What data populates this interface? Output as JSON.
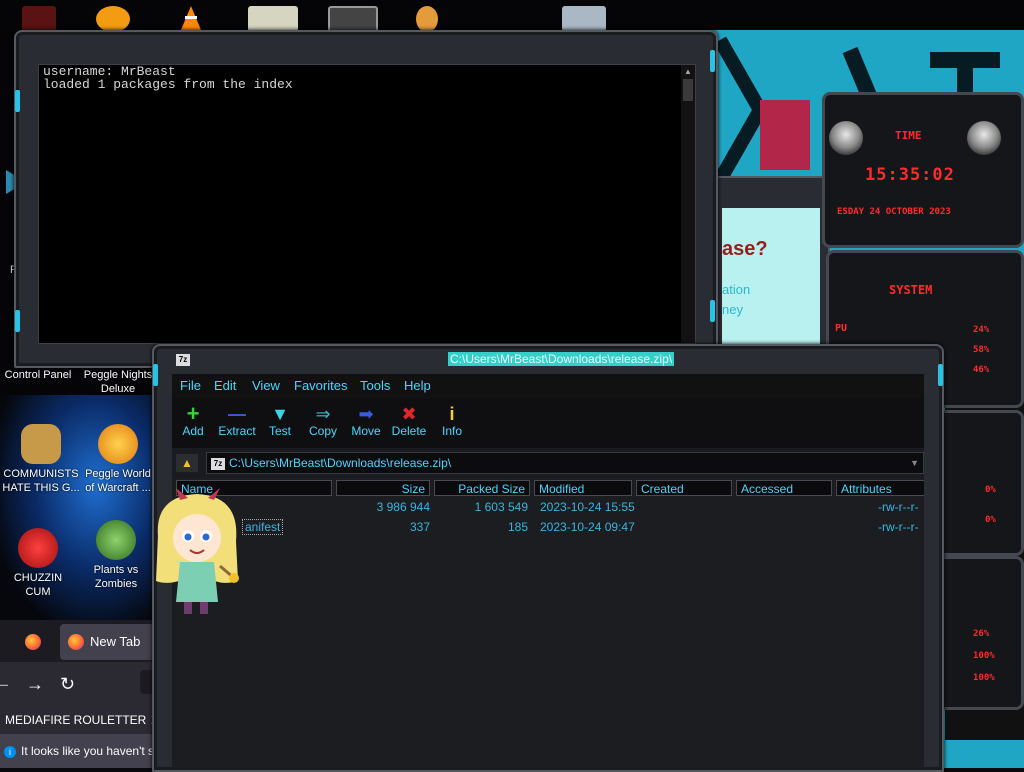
{
  "desktop": {
    "top_icons": [
      {
        "name": "app-icon-1",
        "color": "#c0392b"
      },
      {
        "name": "app-icon-2",
        "color": "#f39c12"
      },
      {
        "name": "vlc-icon",
        "color": "#ff8800"
      },
      {
        "name": "app-icon-4",
        "color": "#d5d5c0"
      },
      {
        "name": "app-icon-5",
        "color": "#999999"
      },
      {
        "name": "app-icon-6",
        "color": "#e49b3b"
      },
      {
        "name": "app-icon-7",
        "color": "#aab7c4"
      }
    ],
    "left_icons": [
      {
        "label": "Control Panel"
      },
      {
        "label": "Peggle Nights Deluxe"
      },
      {
        "label": "COMMUNISTS HATE THIS G..."
      },
      {
        "label": "Peggle World of Warcraft ..."
      },
      {
        "label": "CHUZZIN CUM"
      },
      {
        "label": "Plants vs Zombies"
      }
    ],
    "partial_label": "Re"
  },
  "browser": {
    "tab_label": "New Tab",
    "bookmark": "MEDIAFIRE ROULETTER",
    "notice": "It looks like you haven't sta"
  },
  "console": {
    "lines": [
      "username: MrBeast",
      "loaded 1 packages from the index"
    ]
  },
  "bg_window": {
    "heading": "ase?",
    "line1": "ation",
    "line2": "ney"
  },
  "gadgets": {
    "time_label": "TIME",
    "clock": "15:35:02",
    "date": "ESDAY 24 OCTOBER 2023",
    "system_label": "SYSTEM",
    "cpu_label": "PU",
    "sys_values": [
      "24%",
      "58%",
      "46%"
    ],
    "disk_values": [
      "0%",
      "0%"
    ],
    "net_values": [
      "26%",
      "100%",
      "100%"
    ]
  },
  "sevenzip": {
    "title": "C:\\Users\\MrBeast\\Downloads\\release.zip\\",
    "address": "C:\\Users\\MrBeast\\Downloads\\release.zip\\",
    "menu": [
      "File",
      "Edit",
      "View",
      "Favorites",
      "Tools",
      "Help"
    ],
    "toolbar": [
      {
        "label": "Add",
        "icon": "+",
        "color": "#3ad13a"
      },
      {
        "label": "Extract",
        "icon": "—",
        "color": "#3a5be0"
      },
      {
        "label": "Test",
        "icon": "▼",
        "color": "#39d6e8"
      },
      {
        "label": "Copy",
        "icon": "⇒",
        "color": "#3ab7c9"
      },
      {
        "label": "Move",
        "icon": "➡",
        "color": "#3a5be0"
      },
      {
        "label": "Delete",
        "icon": "✖",
        "color": "#e02828"
      },
      {
        "label": "Info",
        "icon": "i",
        "color": "#f2d22a"
      }
    ],
    "columns": [
      "Name",
      "Size",
      "Packed Size",
      "Modified",
      "Created",
      "Accessed",
      "Attributes"
    ],
    "rows": [
      {
        "name": "",
        "size": "3 986 944",
        "packed": "1 603 549",
        "modified": "2023-10-24 15:55",
        "attributes": "-rw-r--r-"
      },
      {
        "name": "anifest",
        "size": "337",
        "packed": "185",
        "modified": "2023-10-24 09:47",
        "attributes": "-rw-r--r-"
      }
    ]
  }
}
